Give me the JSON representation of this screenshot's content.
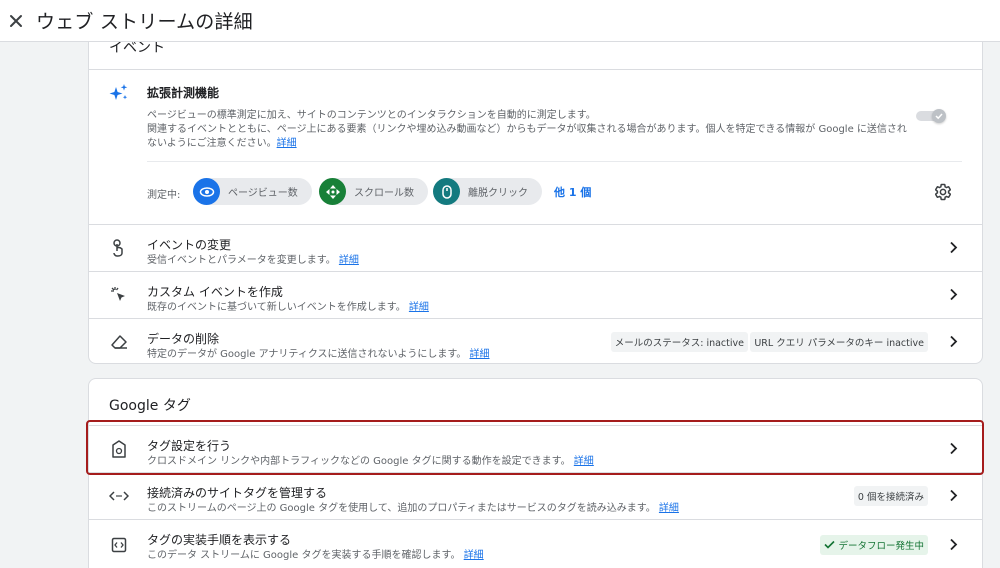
{
  "header": {
    "title": "ウェブ ストリームの詳細"
  },
  "events": {
    "section_title": "イベント",
    "enhanced_measurement": {
      "title": "拡張計測機能",
      "description_1": "ページビューの標準測定に加え、サイトのコンテンツとのインタラクションを自動的に測定します。",
      "description_2": "関連するイベントとともに、ページ上にある要素（リンクや埋め込み動画など）からもデータが収集される場合があります。個人を特定できる情報が Google に送信され",
      "description_3": "ないようにご注意ください。",
      "link": "詳細",
      "toggle_on": true
    },
    "measuring": {
      "label": "測定中:",
      "chips": [
        {
          "label": "ページビュー数",
          "icon": "eye-icon",
          "color": "#1a73e8"
        },
        {
          "label": "スクロール数",
          "icon": "scroll-icon",
          "color": "#188038"
        },
        {
          "label": "離脱クリック",
          "icon": "mouse-icon",
          "color": "#137a7f"
        }
      ],
      "more": "他 1 個"
    },
    "rows": [
      {
        "title": "イベントの変更",
        "desc": "受信イベントとパラメータを変更します。",
        "link": "詳細"
      },
      {
        "title": "カスタム イベントを作成",
        "desc": "既存のイベントに基づいて新しいイベントを作成します。",
        "link": "詳細"
      },
      {
        "title": "データの削除",
        "desc": "特定のデータが Google アナリティクスに送信されないようにします。",
        "link": "詳細",
        "badges": [
          "メールのステータス: inactive",
          "URL クエリ パラメータのキー inactive"
        ]
      }
    ]
  },
  "google_tag": {
    "section_title": "Google タグ",
    "rows": [
      {
        "title": "タグ設定を行う",
        "desc": "クロスドメイン リンクや内部トラフィックなどの Google タグに関する動作を設定できます。",
        "link": "詳細"
      },
      {
        "title": "接続済みのサイトタグを管理する",
        "desc": "このストリームのページ上の Google タグを使用して、追加のプロパティまたはサービスのタグを読み込みます。",
        "link": "詳細",
        "badge": "0 個を接続済み"
      },
      {
        "title": "タグの実装手順を表示する",
        "desc": "このデータ ストリームに Google タグを実装する手順を確認します。",
        "link": "詳細",
        "badge": "データフロー発生中"
      }
    ]
  },
  "colors": {
    "accent": "#1a73e8",
    "highlight": "#a51c1c",
    "success": "#137333"
  }
}
